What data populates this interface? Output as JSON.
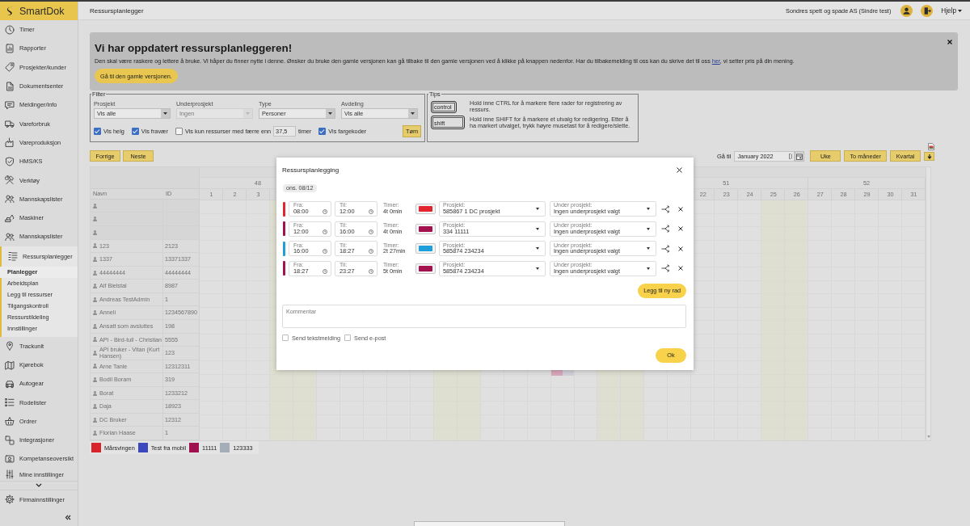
{
  "app": {
    "logo": "SmartDok"
  },
  "header": {
    "title": "Ressursplanlegger",
    "company": "Sondres spett og spade AS (Sindre test)",
    "help": "Hjelp"
  },
  "sidebar": {
    "items": [
      {
        "label": "Timer",
        "selected": false
      },
      {
        "label": "Rapporter",
        "selected": false
      },
      {
        "label": "Prosjekter/kunder",
        "selected": false
      },
      {
        "label": "Dokumentsenter",
        "selected": false
      },
      {
        "label": "Meldinger/info",
        "selected": false
      },
      {
        "label": "Vareforbruk",
        "selected": false
      },
      {
        "label": "Vareproduksjon",
        "selected": false
      },
      {
        "label": "HMS/KS",
        "selected": false
      },
      {
        "label": "Verktøy",
        "selected": false
      },
      {
        "label": "Mannskapslister",
        "selected": false
      },
      {
        "label": "Maskiner",
        "selected": false
      },
      {
        "label": "Mannskapslister",
        "selected": false
      },
      {
        "label": "Ressursplanlegger",
        "selected": true,
        "children": [
          {
            "label": "Planlegger",
            "selected": true
          },
          {
            "label": "Arbeidsplan",
            "selected": false
          },
          {
            "label": "Legg til ressurser",
            "selected": false
          },
          {
            "label": "Tilgangskontroll",
            "selected": false
          },
          {
            "label": "Ressurstildeling",
            "selected": false
          },
          {
            "label": "Innstillinger",
            "selected": false
          }
        ]
      },
      {
        "label": "Trackunit",
        "selected": false
      },
      {
        "label": "Kjørebok",
        "selected": false
      },
      {
        "label": "Autogear",
        "selected": false
      },
      {
        "label": "Rodelister",
        "selected": false
      },
      {
        "label": "Ordrer",
        "selected": false
      },
      {
        "label": "Integrasjoner",
        "selected": false
      },
      {
        "label": "Kompetanseoversikt",
        "selected": false
      },
      {
        "label": "Mine innstillinger",
        "selected": false
      }
    ],
    "footer_item": {
      "label": "Firmainnstillinger"
    }
  },
  "banner": {
    "title": "Vi har oppdatert ressursplanleggeren!",
    "message": {
      "before": "Den skal være raskere og lettere å bruke. Vi håper du finner nytte i denne. Ønsker du bruke den gamle versjonen kan gå tilbake til den gamle versjonen ved å klikke på knappen nedenfor. Har du tilbakemelding til oss kan du skrive det til oss ",
      "link": "her",
      "after": ", vi setter pris på din mening."
    },
    "button": "Gå til den gamle versjonen."
  },
  "filter": {
    "legend": "Filter",
    "fields": [
      {
        "label": "Prosjekt",
        "value": "Vis alle",
        "disabled": false
      },
      {
        "label": "Underprosjekt",
        "value": "Ingen",
        "disabled": true
      },
      {
        "label": "Type",
        "value": "Personer",
        "disabled": false
      },
      {
        "label": "Avdeling",
        "value": "Vis alle",
        "disabled": false
      }
    ],
    "options": [
      {
        "kind": "checkbox",
        "label": "Vis helg",
        "checked": true
      },
      {
        "kind": "checkbox",
        "label": "Vis fravær",
        "checked": true
      },
      {
        "kind": "threshold",
        "label": "Vis kun ressurser med færre enn",
        "checked": false,
        "value": "37,5",
        "unit": "timer"
      },
      {
        "kind": "checkbox",
        "label": "Vis fargekoder",
        "checked": true
      }
    ],
    "clear_button": "Tøm"
  },
  "tips": {
    "legend": "Tips",
    "items": [
      {
        "key": "control",
        "text": "Hold inne CTRL for å markere flere rader for registrering av ressurs."
      },
      {
        "key": "shift",
        "text": "Hold inne SHIFT for å markere et utvalg for redigering. Etter å ha markert utvalget, trykk høyre musetast for å redigere/slette."
      }
    ]
  },
  "navigation": {
    "buttons": [
      "Forrige",
      "Neste"
    ],
    "goto_label": "Gå til",
    "goto_value": "January 2022",
    "views": [
      "Uke",
      "To måneder",
      "Kvartal"
    ]
  },
  "calendar": {
    "columns": [
      "Navn",
      "ID"
    ],
    "weeks": [
      {
        "label": "48",
        "days": [
          "1",
          "2",
          "3"
        ]
      },
      {
        "label": "51",
        "days": [
          "22",
          "23",
          "24",
          "25",
          "26"
        ]
      },
      {
        "label": "52",
        "days": [
          "27",
          "28",
          "29",
          "30",
          "31"
        ]
      }
    ],
    "rows": [
      {
        "kind": "blank"
      },
      {
        "kind": "blank"
      },
      {
        "kind": "blank"
      },
      {
        "kind": "person",
        "name": "123",
        "id": "2123"
      },
      {
        "kind": "person",
        "name": "1337",
        "id": "13371337"
      },
      {
        "kind": "person",
        "name": "44444444",
        "id": "44444444"
      },
      {
        "kind": "person",
        "name": "Alf Bielstal",
        "id": "8987"
      },
      {
        "kind": "person",
        "name": "Andreas TestAdmin",
        "id": "1"
      },
      {
        "kind": "person",
        "name": "Anneli",
        "id": "1234567890"
      },
      {
        "kind": "person",
        "name": "Ansatt som avsluttes",
        "id": "198"
      },
      {
        "kind": "person",
        "name": "API - Bird-tull - Christian",
        "id": "5555"
      },
      {
        "kind": "person",
        "name": "API bruker - Vitan (Kurt Hansen)",
        "id": "123"
      },
      {
        "kind": "person",
        "name": "Arne Tanle",
        "id": "12312311"
      },
      {
        "kind": "person",
        "name": "Bodil Boram",
        "id": "319"
      },
      {
        "kind": "person",
        "name": "Borat",
        "id": "1233212"
      },
      {
        "kind": "person",
        "name": "Daja",
        "id": "18923"
      },
      {
        "kind": "person",
        "name": "DC Bruker",
        "id": "12312"
      },
      {
        "kind": "person",
        "name": "Florian Haase",
        "id": "1"
      }
    ],
    "bookings": [
      {
        "color": "#d8a8bb"
      },
      {
        "color": "#cfd0d9"
      }
    ]
  },
  "legend": [
    {
      "label": "Mårsvingen",
      "color": "#d9232b"
    },
    {
      "label": "Test fra mobil",
      "color": "#3a47bd"
    },
    {
      "label": "11111",
      "color": "#a0114f"
    },
    {
      "label": "123333",
      "color": "#a5adb9"
    }
  ],
  "modal": {
    "title": "Ressursplanlegging",
    "date": "ons. 08/12",
    "rows": [
      {
        "color": "#e2262f",
        "from_label": "Fra:",
        "from": "08:00",
        "to_label": "Til:",
        "to": "12:00",
        "hours_label": "Timer:",
        "hours": "4t 0min",
        "project_label": "Prosjekt:",
        "project": "585867 1 DC prosjekt",
        "subproject_label": "Under prosjekt:",
        "subproject": "Ingen underprosjekt valgt"
      },
      {
        "color": "#a3124f",
        "from_label": "Fra:",
        "from": "12:00",
        "to_label": "Til:",
        "to": "16:00",
        "hours_label": "Timer:",
        "hours": "4t 0min",
        "project_label": "Prosjekt:",
        "project": "334 11111",
        "subproject_label": "Under prosjekt:",
        "subproject": "Ingen underprosjekt valgt"
      },
      {
        "color": "#1e9fd9",
        "from_label": "Fra:",
        "from": "16:00",
        "to_label": "Til:",
        "to": "18:27",
        "hours_label": "Timer:",
        "hours": "2t 27min",
        "project_label": "Prosjekt:",
        "project": "585874 234234",
        "subproject_label": "Under prosjekt:",
        "subproject": "Ingen underprosjekt valgt"
      },
      {
        "color": "#a3124f",
        "from_label": "Fra:",
        "from": "18:27",
        "to_label": "Til:",
        "to": "23:27",
        "hours_label": "Timer:",
        "hours": "5t 0min",
        "project_label": "Prosjekt:",
        "project": "585874 234234",
        "subproject_label": "Under prosjekt:",
        "subproject": "Ingen underprosjekt valgt"
      }
    ],
    "add_row": "Legg til ny rad",
    "comment_placeholder": "Kommentar",
    "notify": [
      {
        "label": "Send tekstmelding",
        "checked": false
      },
      {
        "label": "Send e-post",
        "checked": false
      }
    ],
    "ok": "Ok"
  }
}
